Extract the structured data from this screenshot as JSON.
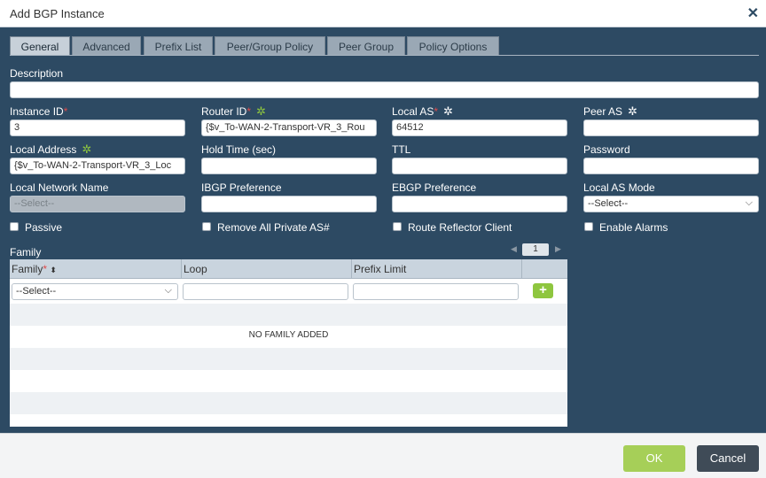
{
  "dialog": {
    "title": "Add BGP Instance",
    "close_icon": "close-icon"
  },
  "tabs": [
    "General",
    "Advanced",
    "Prefix List",
    "Peer/Group Policy",
    "Peer Group",
    "Policy Options"
  ],
  "fields": {
    "description": {
      "label": "Description",
      "value": ""
    },
    "instance_id": {
      "label": "Instance ID",
      "value": "3",
      "required": "*"
    },
    "router_id": {
      "label": "Router ID",
      "value": "{$v_To-WAN-2-Transport-VR_3_Rou",
      "required": "*"
    },
    "local_as": {
      "label": "Local AS",
      "value": "64512",
      "required": "*"
    },
    "peer_as": {
      "label": "Peer AS",
      "value": ""
    },
    "local_address": {
      "label": "Local Address",
      "value": "{$v_To-WAN-2-Transport-VR_3_Loc"
    },
    "hold_time": {
      "label": "Hold Time (sec)",
      "value": ""
    },
    "ttl": {
      "label": "TTL",
      "value": ""
    },
    "password": {
      "label": "Password",
      "value": ""
    },
    "local_network_name": {
      "label": "Local Network Name",
      "value": "--Select--"
    },
    "ibgp_preference": {
      "label": "IBGP Preference",
      "value": ""
    },
    "ebgp_preference": {
      "label": "EBGP Preference",
      "value": ""
    },
    "local_as_mode": {
      "label": "Local AS Mode",
      "value": "--Select--"
    }
  },
  "checkboxes": {
    "passive": "Passive",
    "remove_private_as": "Remove All Private AS#",
    "route_reflector_client": "Route Reflector Client",
    "enable_alarms": "Enable Alarms"
  },
  "family": {
    "label": "Family",
    "page": "1",
    "columns": {
      "family": "Family",
      "loop": "Loop",
      "prefix_limit": "Prefix Limit"
    },
    "required": "*",
    "select_value": "--Select--",
    "add_label": "+",
    "empty_text": "NO FAMILY ADDED"
  },
  "footer": {
    "ok": "OK",
    "cancel": "Cancel"
  },
  "colors": {
    "panel": "#2d4a63",
    "accent_green": "#8ec63f",
    "ok_button": "#a6cf58",
    "cancel_button": "#3f4b57"
  }
}
